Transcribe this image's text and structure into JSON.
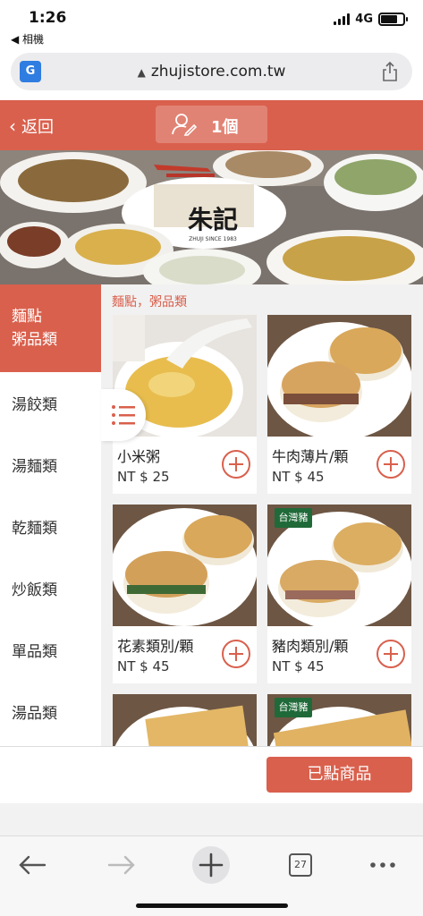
{
  "status_bar": {
    "time": "1:26",
    "back_app": "◀ 相機",
    "network": "4G",
    "battery_level": 0.75
  },
  "browser": {
    "url": "zhujistore.com.tw",
    "tab_count": "27"
  },
  "header": {
    "back_label": "返回",
    "cart_count": "1個"
  },
  "banner": {
    "brand": "朱記",
    "brand_sub": "ZHUJI SINCE 1983"
  },
  "sidebar": {
    "active": "麵點\n粥品類",
    "items": [
      "湯餃類",
      "湯麵類",
      "乾麵類",
      "炒飯類",
      "單品類",
      "湯品類"
    ]
  },
  "content": {
    "category_title": "麵點，粥品類",
    "products": [
      {
        "name": "小米粥",
        "price": "NT $ 25"
      },
      {
        "name": "牛肉薄片/顆",
        "price": "NT $ 45"
      },
      {
        "name": "花素類別/顆",
        "price": "NT $ 45"
      },
      {
        "name": "豬肉類別/顆",
        "price": "NT $ 45",
        "tag": "台灣豬"
      }
    ],
    "partial_tag": "台灣豬"
  },
  "footer": {
    "ordered_button": "已點商品"
  }
}
